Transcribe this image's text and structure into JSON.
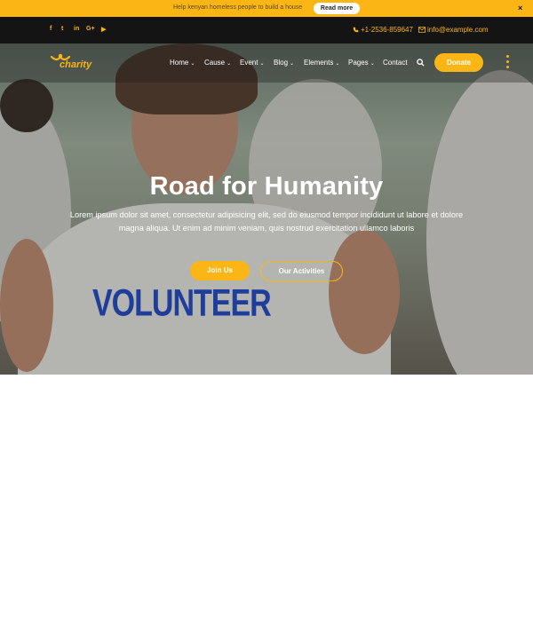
{
  "topbar": {
    "notice": "Help kenyan homeless people to build a house",
    "read_more": "Read more",
    "close": "×"
  },
  "social": [
    {
      "icon": "facebook-icon",
      "glyph": "f"
    },
    {
      "icon": "twitter-icon",
      "glyph": "t"
    },
    {
      "icon": "linkedin-icon",
      "glyph": "in"
    },
    {
      "icon": "google-plus-icon",
      "glyph": "G+"
    },
    {
      "icon": "youtube-icon",
      "glyph": "▶"
    }
  ],
  "contact": {
    "phone": "+1-2536-859647",
    "email": "info@example.com"
  },
  "logo": {
    "text": "charity"
  },
  "nav": {
    "items": [
      {
        "label": "Home",
        "dropdown": true
      },
      {
        "label": "Cause",
        "dropdown": true
      },
      {
        "label": "Event",
        "dropdown": true
      },
      {
        "label": "Blog",
        "dropdown": true
      },
      {
        "label": "Elements",
        "dropdown": true
      },
      {
        "label": "Pages",
        "dropdown": true
      },
      {
        "label": "Contact",
        "dropdown": false
      }
    ],
    "donate": "Donate"
  },
  "hero": {
    "title": "Road for Humanity",
    "text": "Lorem ipsum dolor sit amet, consectetur adipisicing elit, sed do eiusmod tempor incididunt ut labore et dolore magna aliqua. Ut enim ad minim veniam, quis nostrud exercitation ullamco laboris",
    "join_button": "Join Us",
    "activities_button": "Our Activities",
    "shirt_text": "VOLUNTEER"
  },
  "colors": {
    "accent": "#fbb616",
    "dark": "#141414"
  }
}
